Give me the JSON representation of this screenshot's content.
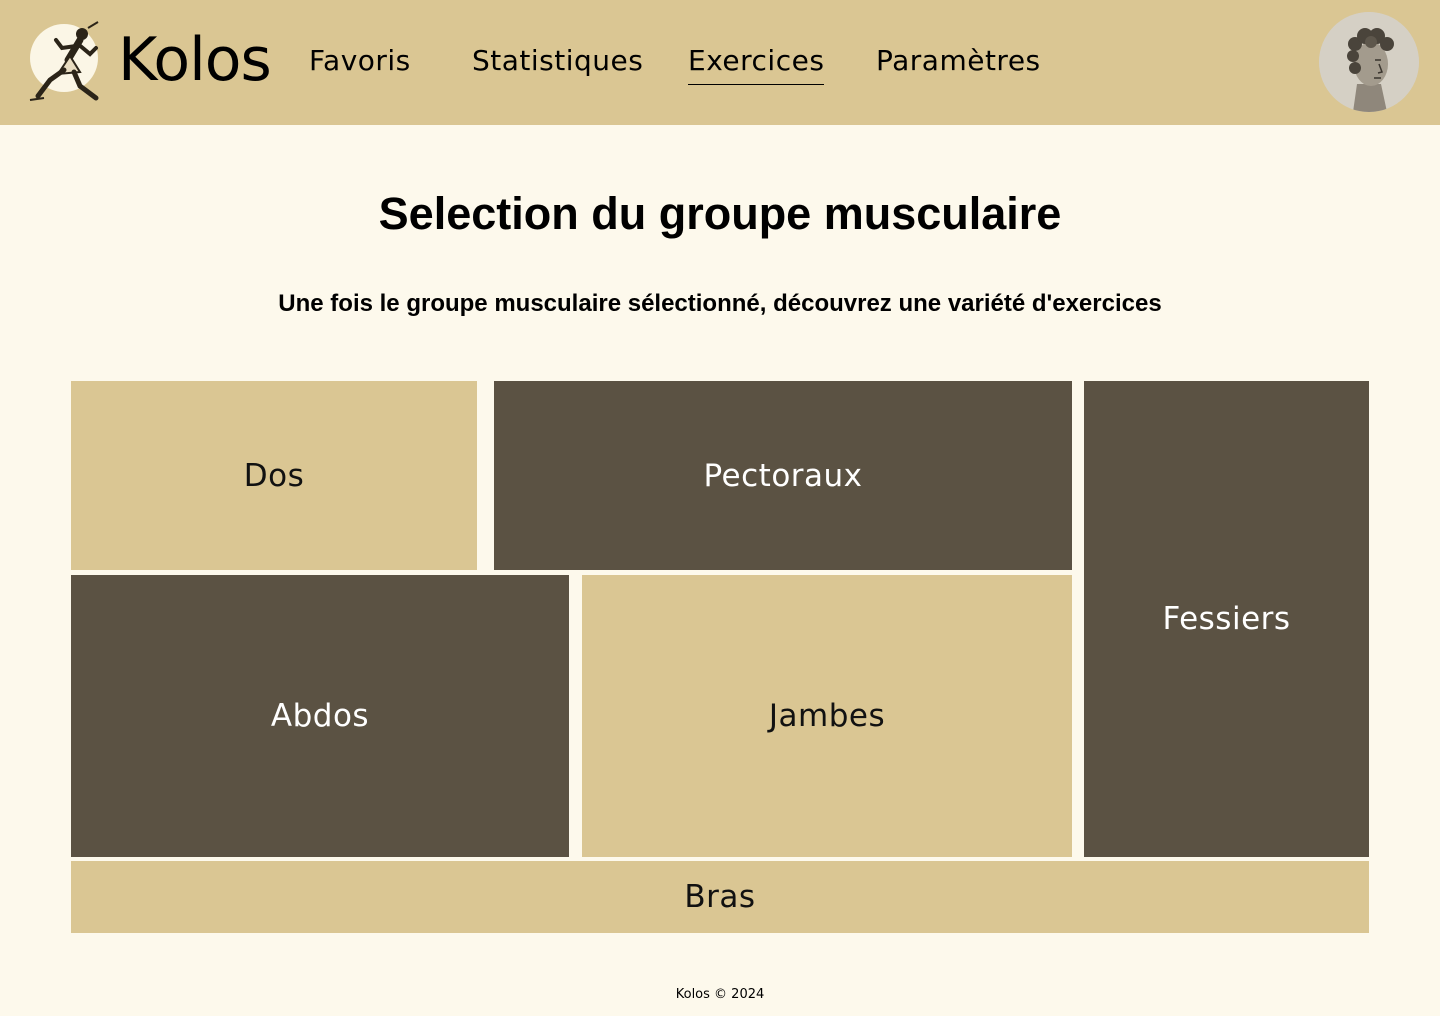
{
  "header": {
    "brand": "Kolos",
    "logo_icon": "running-athlete-icon",
    "avatar_icon": "greek-statue-bust-icon",
    "nav": {
      "favoris": "Favoris",
      "statistiques": "Statistiques",
      "exercices": "Exercices",
      "parametres": "Paramètres"
    },
    "active_nav": "Exercices"
  },
  "main": {
    "title": "Selection du groupe musculaire",
    "subtitle": "Une fois le groupe musculaire sélectionné, découvrez une variété d'exercices",
    "groups": {
      "dos": "Dos",
      "pectoraux": "Pectoraux",
      "fessiers": "Fessiers",
      "abdos": "Abdos",
      "jambes": "Jambes",
      "bras": "Bras"
    }
  },
  "footer": {
    "text": "Kolos © 2024"
  },
  "colors": {
    "header_bg": "#dac693",
    "page_bg": "#fdf9ec",
    "tile_light": "#dac693",
    "tile_dark": "#5b5243"
  }
}
